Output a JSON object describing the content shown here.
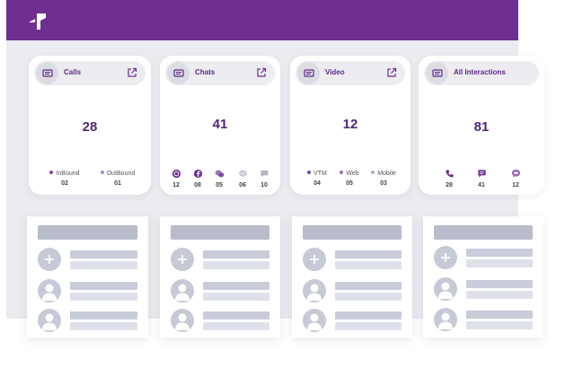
{
  "cards": [
    {
      "id": "calls",
      "title": "Calls",
      "total": "28",
      "stats": [
        {
          "label": "InBound",
          "value": "02"
        },
        {
          "label": "OutBound",
          "value": "01"
        }
      ]
    },
    {
      "id": "chats",
      "title": "Chats",
      "total": "41",
      "stats": [
        {
          "icon": "whatsapp-icon",
          "value": "12"
        },
        {
          "icon": "facebook-icon",
          "value": "08"
        },
        {
          "icon": "wechat-icon",
          "value": "05"
        },
        {
          "icon": "sms-icon",
          "value": "06"
        },
        {
          "icon": "webchat-icon",
          "value": "10"
        }
      ]
    },
    {
      "id": "video",
      "title": "Video",
      "total": "12",
      "stats": [
        {
          "label": "VTM",
          "value": "04"
        },
        {
          "label": "Web",
          "value": "05"
        },
        {
          "label": "Mobile",
          "value": "03"
        }
      ]
    },
    {
      "id": "all",
      "title": "All Interactions",
      "total": "81",
      "stats": [
        {
          "icon": "phone-icon",
          "value": "28"
        },
        {
          "icon": "chat-icon",
          "value": "41"
        },
        {
          "icon": "video-icon",
          "value": "12"
        }
      ]
    }
  ],
  "colors": {
    "brand": "#6f2f91",
    "number": "#4e2776",
    "label": "#5e2a85"
  }
}
